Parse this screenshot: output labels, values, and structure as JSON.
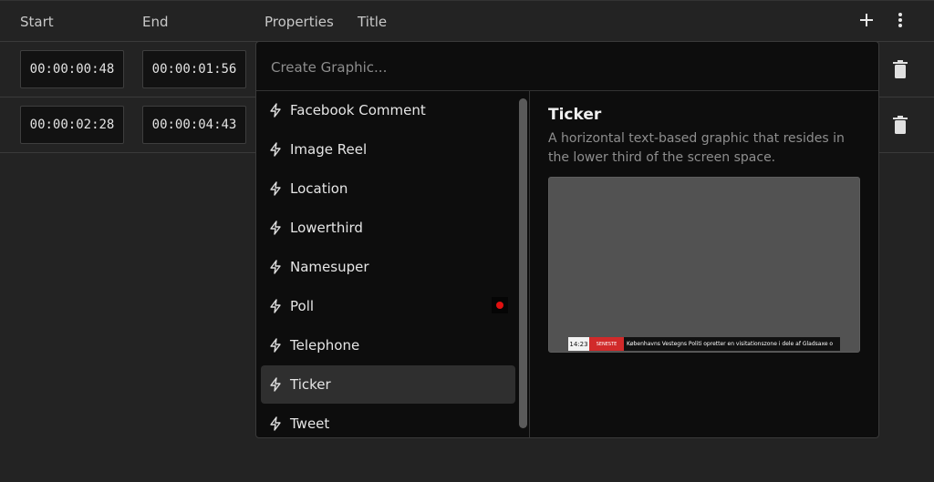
{
  "header": {
    "col_start": "Start",
    "col_end": "End",
    "col_properties": "Properties",
    "col_title": "Title",
    "add_icon": "plus-icon",
    "more_icon": "kebab-menu-icon"
  },
  "rows": [
    {
      "start": "00:00:00:48",
      "end": "00:00:01:56"
    },
    {
      "start": "00:00:02:28",
      "end": "00:00:04:43"
    }
  ],
  "popup": {
    "search_placeholder": "Create Graphic...",
    "items": [
      {
        "label": "Facebook Comment"
      },
      {
        "label": "Image Reel"
      },
      {
        "label": "Location"
      },
      {
        "label": "Lowerthird"
      },
      {
        "label": "Namesuper"
      },
      {
        "label": "Poll"
      },
      {
        "label": "Telephone"
      },
      {
        "label": "Ticker"
      },
      {
        "label": "Tweet"
      }
    ],
    "selected": "Ticker",
    "detail": {
      "title": "Ticker",
      "description": "A horizontal text-based graphic that resides in the lower third of the screen space.",
      "preview_time": "14:23",
      "preview_label": "SENESTE",
      "preview_text": "Københavns Vestegns Politi opretter en visitationszone i dele af Gladsaxe o"
    }
  },
  "colors": {
    "selected_bg": "#2f2f2f",
    "ticker_red": "#d12a2a",
    "record_dot": "#e01010"
  }
}
